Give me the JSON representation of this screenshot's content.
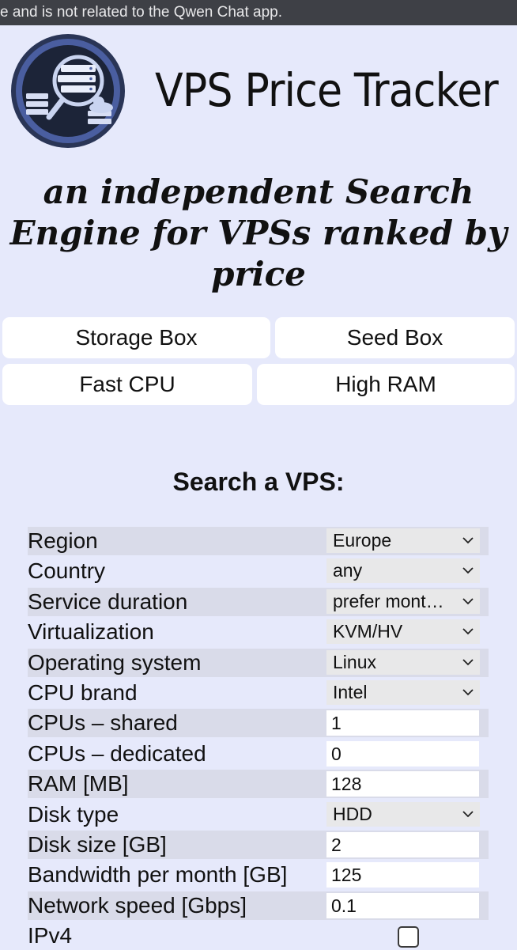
{
  "banner": {
    "text": "e and is not related to the Qwen Chat app."
  },
  "header": {
    "brand": "VPS Price Tracker"
  },
  "tagline": "an independent Search Engine for VPSs ranked by price",
  "quick_links": [
    "Storage Box",
    "Seed Box",
    "Fast CPU",
    "High RAM"
  ],
  "search": {
    "title": "Search a VPS:",
    "fields": [
      {
        "label": "Region",
        "type": "select",
        "value": "Europe"
      },
      {
        "label": "Country",
        "type": "select",
        "value": "any"
      },
      {
        "label": "Service duration",
        "type": "select",
        "value": "prefer mont…"
      },
      {
        "label": "Virtualization",
        "type": "select",
        "value": "KVM/HV"
      },
      {
        "label": "Operating system",
        "type": "select",
        "value": "Linux"
      },
      {
        "label": "CPU brand",
        "type": "select",
        "value": "Intel"
      },
      {
        "label": "CPUs – shared",
        "type": "input",
        "value": "1"
      },
      {
        "label": "CPUs – dedicated",
        "type": "input",
        "value": "0"
      },
      {
        "label": "RAM [MB]",
        "type": "input",
        "value": "128"
      },
      {
        "label": "Disk type",
        "type": "select",
        "value": "HDD"
      },
      {
        "label": "Disk size [GB]",
        "type": "input",
        "value": "2"
      },
      {
        "label": "Bandwidth per month [GB]",
        "type": "input",
        "value": "125"
      },
      {
        "label": "Network speed [Gbps]",
        "type": "input",
        "value": "0.1"
      },
      {
        "label": "IPv4",
        "type": "checkbox",
        "checked": false
      }
    ]
  },
  "colors": {
    "page_background": "#e6e9fb",
    "status_bar": "#3e4046",
    "row_shade": "#d9dbe9",
    "logo_ring": "#4a5ea0",
    "logo_inner": "#1c2438"
  },
  "icons": [
    "logo-magnifier-servers-icon",
    "chevron-down-icon"
  ]
}
